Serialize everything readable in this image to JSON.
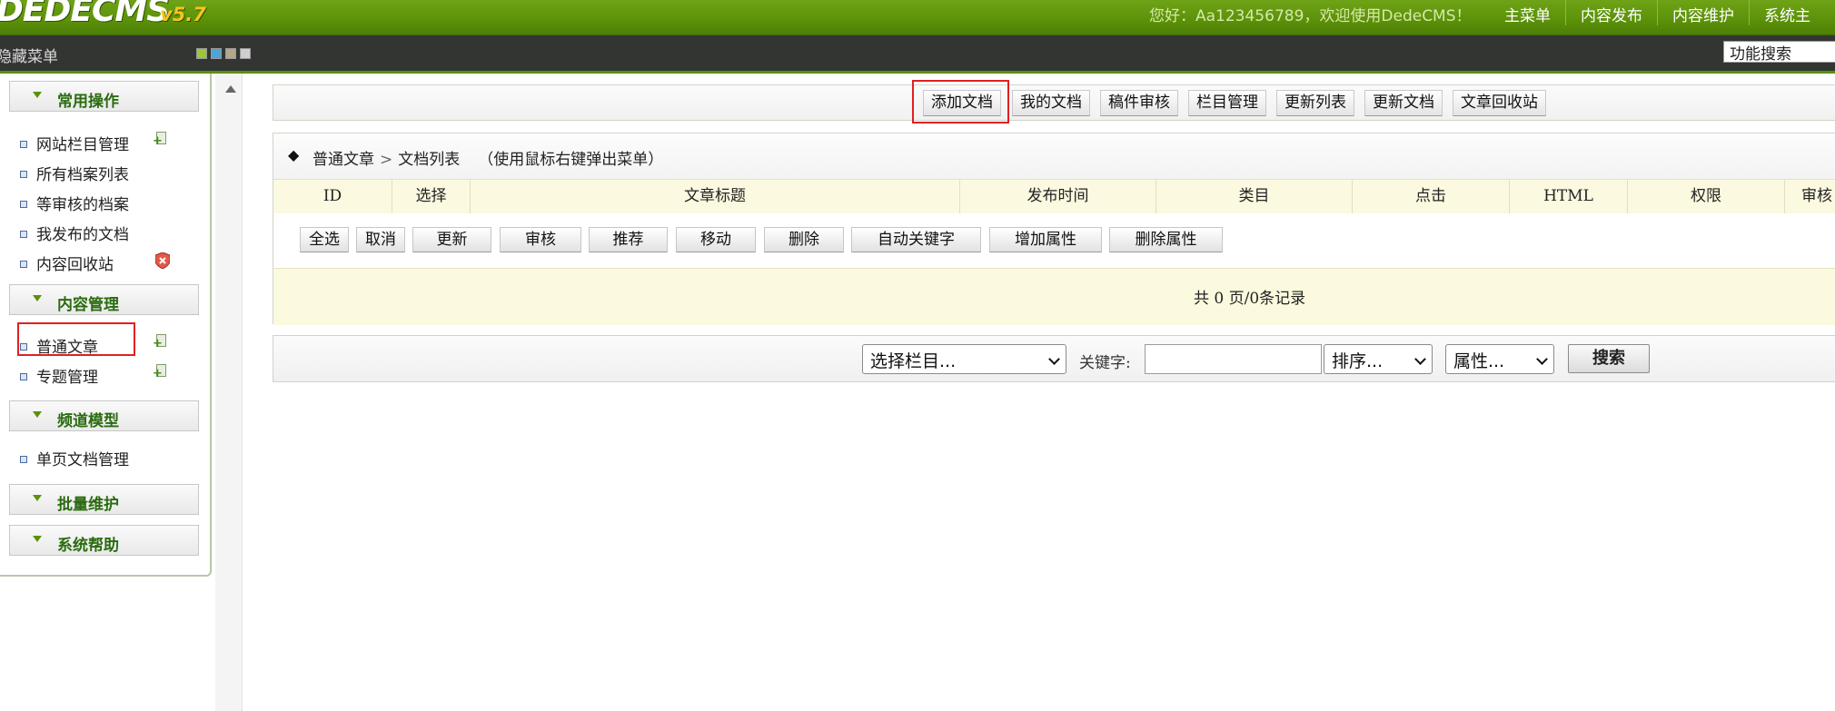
{
  "header": {
    "logo_text": "DEDECMS",
    "logo_version": "v5.7",
    "welcome": "您好：Aa123456789，欢迎使用DedeCMS！",
    "nav": [
      "主菜单",
      "内容发布",
      "内容维护",
      "系统主"
    ]
  },
  "subbar": {
    "hide_menu": "隐藏菜单",
    "skin_colors": [
      "#9bc73a",
      "#4fa3d6",
      "#b5a58a",
      "#cfcfcf"
    ],
    "search_value": "功能搜索"
  },
  "sidebar": {
    "groups": [
      {
        "title": "常用操作",
        "items": [
          {
            "label": "网站栏目管理",
            "icon": "add-icon"
          },
          {
            "label": "所有档案列表",
            "icon": ""
          },
          {
            "label": "等审核的档案",
            "icon": ""
          },
          {
            "label": "我发布的文档",
            "icon": ""
          },
          {
            "label": "内容回收站",
            "icon": "shield-icon"
          }
        ]
      },
      {
        "title": "内容管理",
        "items": [
          {
            "label": "普通文章",
            "icon": "add-icon"
          },
          {
            "label": "专题管理",
            "icon": "add-icon"
          }
        ]
      },
      {
        "title": "频道模型",
        "items": [
          {
            "label": "单页文档管理",
            "icon": ""
          }
        ]
      },
      {
        "title": "批量维护",
        "items": []
      },
      {
        "title": "系统帮助",
        "items": []
      }
    ]
  },
  "toolbar": {
    "buttons": [
      "添加文档",
      "我的文档",
      "稿件审核",
      "栏目管理",
      "更新列表",
      "更新文档",
      "文章回收站"
    ]
  },
  "list": {
    "breadcrumb_root": "普通文章",
    "breadcrumb_sep": ">",
    "breadcrumb_leaf": "文档列表",
    "hint": "（使用鼠标右键弹出菜单）",
    "columns": [
      "ID",
      "选择",
      "文章标题",
      "发布时间",
      "类目",
      "点击",
      "HTML",
      "权限",
      "审核"
    ],
    "actions": [
      "全选",
      "取消",
      "更新",
      "审核",
      "推荐",
      "移动",
      "删除",
      "自动关键字",
      "增加属性",
      "删除属性"
    ],
    "pager": "共 0 页/0条记录"
  },
  "search": {
    "category_select": "选择栏目...",
    "keyword_label": "关键字:",
    "keyword_value": "",
    "order_select": "排序...",
    "attr_select": "属性...",
    "submit": "搜索"
  },
  "colors": {
    "header_green": "#5b9109",
    "dark_bar": "#333533",
    "highlight_red": "#e02020",
    "group_title_green": "#2a6b10",
    "table_header_bg": "#fbf9df"
  }
}
